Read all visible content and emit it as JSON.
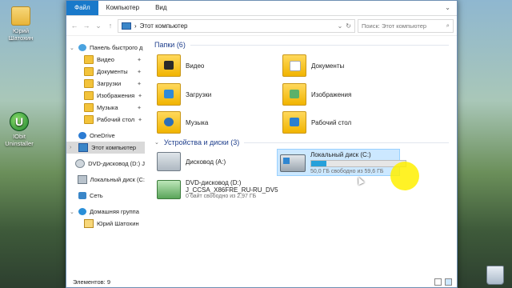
{
  "desktop": {
    "icons": [
      {
        "label": "Юрий Шатохин"
      },
      {
        "label": "IObit Uninstaller"
      }
    ]
  },
  "ribbon": {
    "tabs": [
      "Файл",
      "Компьютер",
      "Вид"
    ]
  },
  "address": {
    "path": "Этот компьютер",
    "search_placeholder": "Поиск: Этот компьютер"
  },
  "nav": {
    "quick_access": "Панель быстрого д",
    "items": [
      {
        "label": "Видео",
        "icon": "video-folder-icon"
      },
      {
        "label": "Документы",
        "icon": "documents-folder-icon"
      },
      {
        "label": "Загрузки",
        "icon": "downloads-folder-icon"
      },
      {
        "label": "Изображения",
        "icon": "pictures-folder-icon"
      },
      {
        "label": "Музыка",
        "icon": "music-folder-icon"
      },
      {
        "label": "Рабочий стол",
        "icon": "desktop-folder-icon"
      }
    ],
    "onedrive": "OneDrive",
    "this_pc": "Этот компьютер",
    "dvd": "DVD-дисковод (D:) J",
    "local_disk": "Локальный диск (C:",
    "network": "Сеть",
    "homegroup": "Домашняя группа",
    "user": "Юрий Шатохин"
  },
  "content": {
    "folders_header": "Папки (6)",
    "folders": [
      {
        "label": "Видео"
      },
      {
        "label": "Документы"
      },
      {
        "label": "Загрузки"
      },
      {
        "label": "Изображения"
      },
      {
        "label": "Музыка"
      },
      {
        "label": "Рабочий стол"
      }
    ],
    "devices_header": "Устройства и диски (3)",
    "devices": {
      "floppy": "Дисковод (A:)",
      "local": {
        "label": "Локальный диск (C:)",
        "free": "50,0 ГБ свободно из 59,6 ГБ",
        "used_fraction": 0.16
      },
      "dvd": {
        "label": "DVD-дисковод (D:)",
        "volume": "J_CCSA_X86FRE_RU-RU_DV5",
        "free": "0 байт свободно из 2,97 ГБ"
      }
    }
  },
  "status": {
    "items": "Элементов: 9"
  }
}
